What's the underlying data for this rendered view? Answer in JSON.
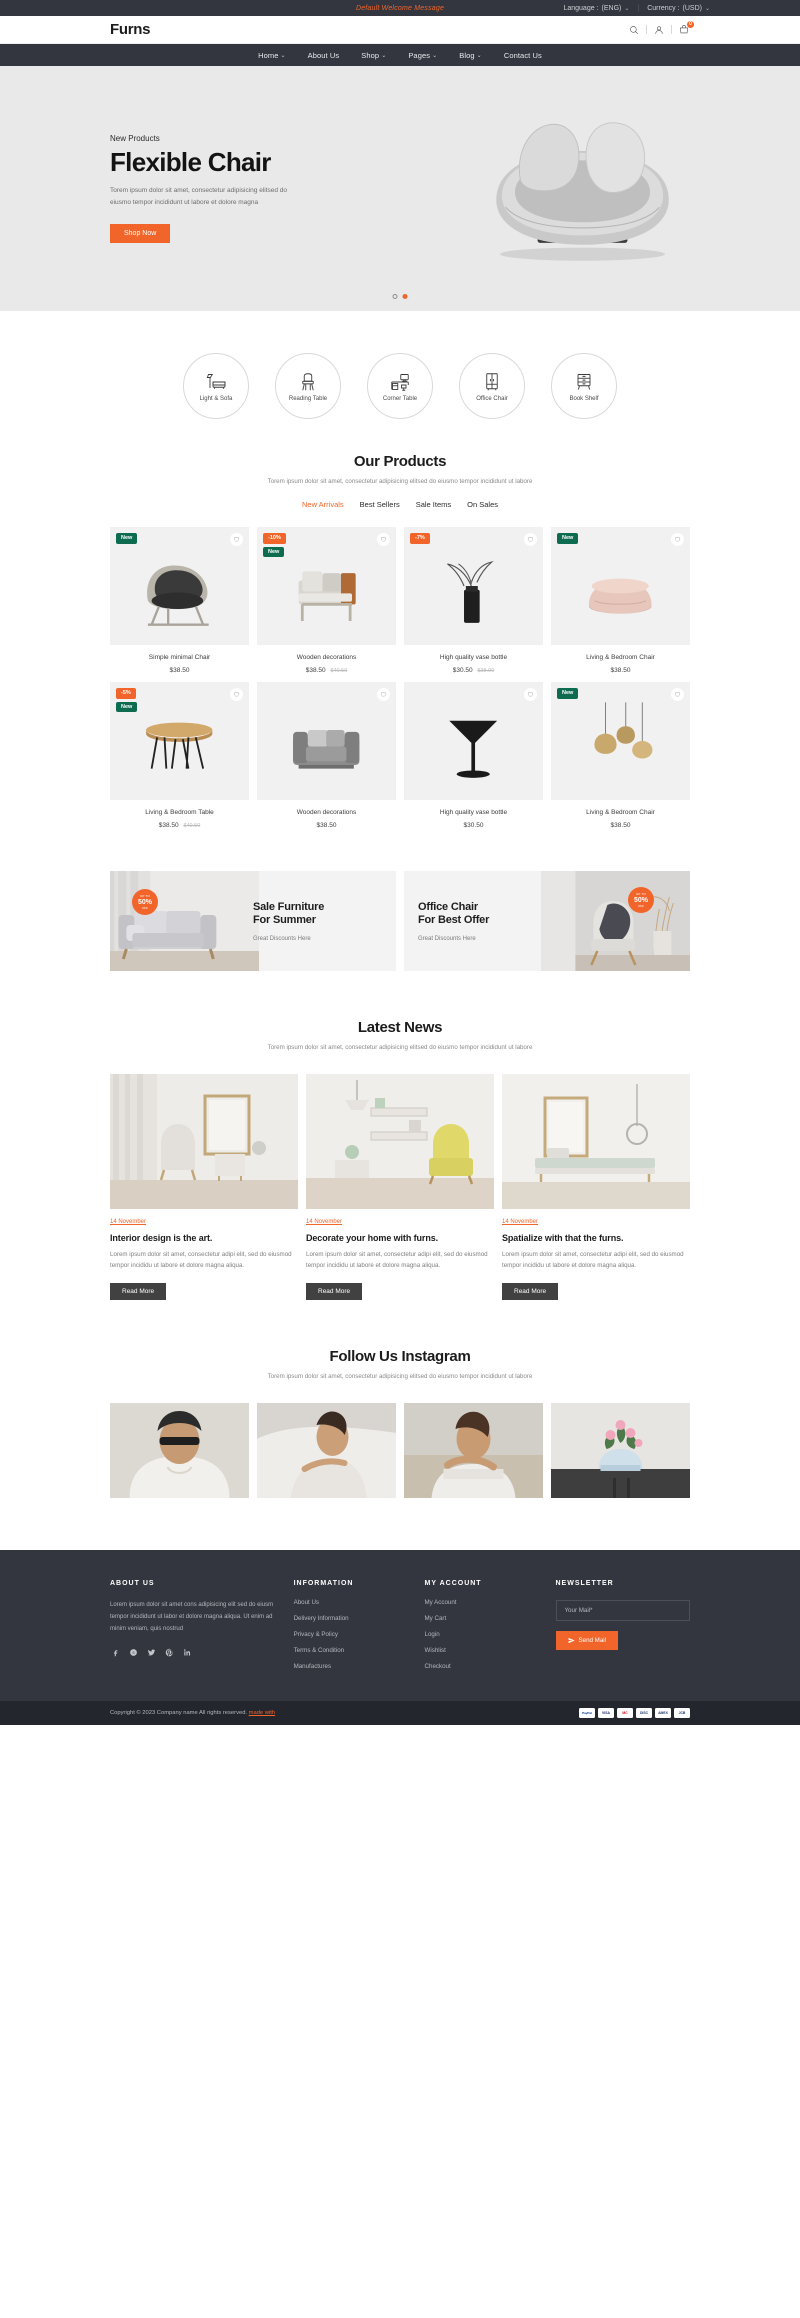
{
  "topbar": {
    "welcome": "Default Welcome Message",
    "language_label": "Language :",
    "language_value": "(ENG)",
    "currency_label": "Currency :",
    "currency_value": "(USD)"
  },
  "header": {
    "logo": "Furns",
    "cart_count": "0"
  },
  "nav": {
    "items": [
      {
        "label": "Home",
        "caret": "⌄"
      },
      {
        "label": "About Us",
        "caret": ""
      },
      {
        "label": "Shop",
        "caret": "⌄"
      },
      {
        "label": "Pages",
        "caret": "⌄"
      },
      {
        "label": "Blog",
        "caret": "⌄"
      },
      {
        "label": "Contact Us",
        "caret": ""
      }
    ]
  },
  "hero": {
    "eyebrow": "New Products",
    "title": "Flexible Chair",
    "description": "Torem ipsum dolor sit amet, consectetur adipisicing elitsed do eiusmo tempor incididunt ut labore et dolore magna",
    "cta": "Shop Now"
  },
  "categories": [
    {
      "label": "Light & Sofa",
      "icon": "floor-lamp-sofa-icon"
    },
    {
      "label": "Reading Table",
      "icon": "chair-icon"
    },
    {
      "label": "Corner Table",
      "icon": "desk-computer-icon"
    },
    {
      "label": "Office Chair",
      "icon": "wardrobe-icon"
    },
    {
      "label": "Book Shelf",
      "icon": "cabinet-icon"
    }
  ],
  "products_section": {
    "title": "Our Products",
    "subtitle": "Torem ipsum dolor sit amet, consectetur adipisicing elitsed do eiusmo tempor incididunt ut labore",
    "tabs": [
      {
        "label": "New Arrivals",
        "active": true
      },
      {
        "label": "Best Sellers",
        "active": false
      },
      {
        "label": "Sale Items",
        "active": false
      },
      {
        "label": "On Sales",
        "active": false
      }
    ],
    "items": [
      {
        "name": "Simple minimal Chair",
        "price": "$38.50",
        "old_price": "",
        "badges": [
          {
            "text": "New",
            "type": "new"
          }
        ],
        "art": "chair-dark"
      },
      {
        "name": "Wooden decorations",
        "price": "$38.50",
        "old_price": "$40.50",
        "badges": [
          {
            "text": "-10%",
            "type": "off"
          },
          {
            "text": "New",
            "type": "new"
          }
        ],
        "art": "armchair-wood"
      },
      {
        "name": "High quality vase bottle",
        "price": "$30.50",
        "old_price": "$38.00",
        "badges": [
          {
            "text": "-7%",
            "type": "off"
          }
        ],
        "art": "vase"
      },
      {
        "name": "Living & Bedroom Chair",
        "price": "$38.50",
        "old_price": "",
        "badges": [
          {
            "text": "New",
            "type": "new"
          }
        ],
        "art": "pouf"
      },
      {
        "name": "Living & Bedroom Table",
        "price": "$38.50",
        "old_price": "$40.50",
        "badges": [
          {
            "text": "-5%",
            "type": "off"
          },
          {
            "text": "New",
            "type": "new"
          }
        ],
        "art": "hairpin-table"
      },
      {
        "name": "Wooden decorations",
        "price": "$38.50",
        "old_price": "",
        "badges": [],
        "art": "grey-sofa"
      },
      {
        "name": "High quality vase bottle",
        "price": "$30.50",
        "old_price": "",
        "badges": [],
        "art": "side-table"
      },
      {
        "name": "Living & Bedroom Chair",
        "price": "$38.50",
        "old_price": "",
        "badges": [
          {
            "text": "New",
            "type": "new"
          }
        ],
        "art": "pendant-lamps"
      }
    ]
  },
  "promos": [
    {
      "title_line1": "Sale Furniture",
      "title_line2": "For Summer",
      "subtitle": "Great Discounts Here",
      "disc_up": "UP TO",
      "disc_num": "50%",
      "disc_off": "OFF"
    },
    {
      "title_line1": "Office Chair",
      "title_line2": "For Best Offer",
      "subtitle": "Great Discounts Here",
      "disc_up": "UP TO",
      "disc_num": "50%",
      "disc_off": "OFF"
    }
  ],
  "news_section": {
    "title": "Latest News",
    "subtitle": "Torem ipsum dolor sit amet, consectetur adipisicing elitsed do eiusmo tempor incididunt ut labore",
    "items": [
      {
        "date": "14 November",
        "title": "Interior design is the art.",
        "excerpt": "Lorem ipsum dolor sit amet, consectetur adipi elit, sed do eiusmod tempor incididu ut labore et dolore magna aliqua.",
        "button": "Read More"
      },
      {
        "date": "14 November",
        "title": "Decorate your home with furns.",
        "excerpt": "Lorem ipsum dolor sit amet, consectetur adipi elit, sed do eiusmod tempor incididu ut labore et dolore magna aliqua.",
        "button": "Read More"
      },
      {
        "date": "14 November",
        "title": "Spatialize with that the furns.",
        "excerpt": "Lorem ipsum dolor sit amet, consectetur adipi elit, sed do eiusmod tempor incididu ut labore et dolore magna aliqua.",
        "button": "Read More"
      }
    ]
  },
  "instagram_section": {
    "title": "Follow Us Instagram",
    "subtitle": "Torem ipsum dolor sit amet, consectetur adipisicing elitsed do eiusmo tempor incididunt ut labore",
    "tiles": [
      {
        "alt": "man-in-white-shirt-sunglasses"
      },
      {
        "alt": "woman-hands-white-sleeves"
      },
      {
        "alt": "woman-leaning-on-arm"
      },
      {
        "alt": "potted-pink-flowers"
      }
    ]
  },
  "footer": {
    "about": {
      "heading": "ABOUT US",
      "text": "Lorem ipsum dolor sit amet cons adipisicing elit sed do eiusm tempor incididunt ut labor et dolore magna aliqua. Ut enim ad minim veniam, quis nostrud",
      "socials": [
        {
          "name": "facebook-icon"
        },
        {
          "name": "skype-icon"
        },
        {
          "name": "twitter-icon"
        },
        {
          "name": "pinterest-icon"
        },
        {
          "name": "linkedin-icon"
        }
      ]
    },
    "information": {
      "heading": "INFORMATION",
      "links": [
        "About Us",
        "Delivery Information",
        "Privacy & Policy",
        "Terms & Condition",
        "Manufactures"
      ]
    },
    "my_account": {
      "heading": "MY ACCOUNT",
      "links": [
        "My Account",
        "My Cart",
        "Login",
        "Wishlist",
        "Checkout"
      ]
    },
    "newsletter": {
      "heading": "NEWSLETTER",
      "placeholder": "Your Mail*",
      "value": "",
      "button": "Send Mail"
    }
  },
  "copyright": {
    "text": "Copyright © 2023 Company name All rights reserved. ",
    "brand": "made with",
    "payments": [
      "PayPal",
      "VISA",
      "MC",
      "DISC",
      "AMEX",
      "JCB"
    ]
  },
  "colors": {
    "accent": "#f2652a",
    "dark": "#33353f",
    "darker": "#24262e",
    "new_badge": "#0d6b4f",
    "hero_bg": "#e9e9e9"
  }
}
